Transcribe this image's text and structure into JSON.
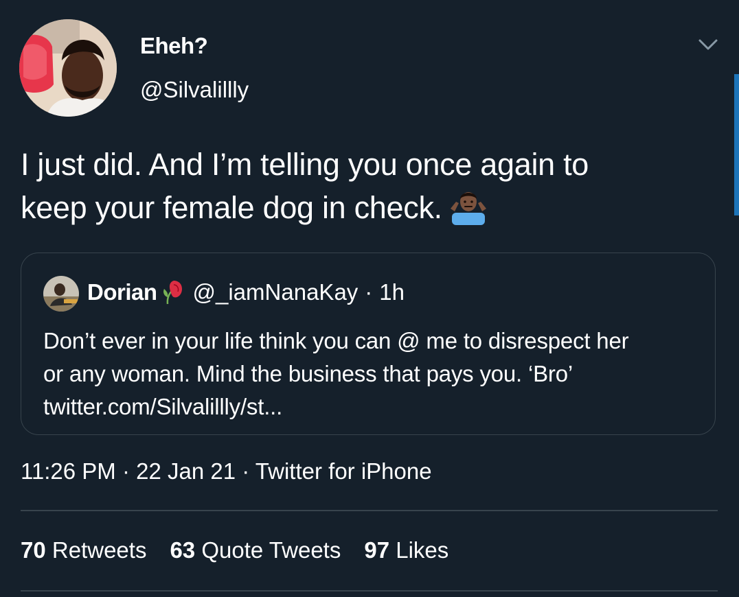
{
  "author": {
    "display_name": "Eheh?",
    "handle": "@Silvalillly"
  },
  "tweet": {
    "text_line1": "I just did. And I’m telling you once again to",
    "text_line2": "keep your female dog in check.",
    "emoji": "man-shrugging-emoji"
  },
  "quoted_tweet": {
    "display_name": "Dorian",
    "name_emoji": "wilted-flower-emoji",
    "handle": "@_iamNanaKay",
    "separator": "·",
    "time": "1h",
    "text_line1": "Don’t ever in your life think you can @ me to disrespect her",
    "text_line2": "or any woman. Mind the business that pays you. ‘Bro’",
    "link": "twitter.com/Silvalillly/st..."
  },
  "meta": {
    "timestamp_line": "11:26 PM · 22 Jan 21 · Twitter for iPhone"
  },
  "stats": {
    "retweets_count": "70",
    "retweets_label": "Retweets",
    "quotes_count": "63",
    "quotes_label": "Quote Tweets",
    "likes_count": "97",
    "likes_label": "Likes"
  },
  "colors": {
    "background": "#15202b",
    "border": "#38444d",
    "scrollbar": "#1d74b8",
    "text": "#ffffff"
  }
}
